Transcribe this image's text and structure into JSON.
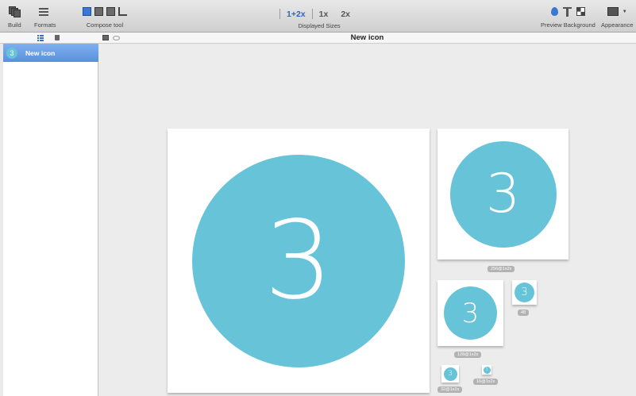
{
  "toolbar": {
    "build_label": "Build",
    "formats_label": "Formats",
    "compose_label": "Compose tool",
    "sizes": [
      {
        "label": "1+2x",
        "active": true
      },
      {
        "label": "1x",
        "active": false
      },
      {
        "label": "2x",
        "active": false
      }
    ],
    "sizes_label": "Displayed Sizes",
    "preview_label": "Preview Background",
    "appearance_label": "Appearance"
  },
  "document": {
    "title": "New icon"
  },
  "sidebar": {
    "items": [
      {
        "label": "New icon",
        "glyph": "3",
        "selected": true
      }
    ]
  },
  "icon": {
    "glyph": "3",
    "color": "#67c4d8",
    "previews": [
      {
        "caption": ""
      },
      {
        "caption": "256@1x2x"
      },
      {
        "caption": "128@1x2x"
      },
      {
        "caption": "48"
      },
      {
        "caption": "32@1x2x"
      },
      {
        "caption": "16@1x2x"
      }
    ]
  },
  "colors": {
    "accent": "#2f68b8",
    "selection": "#6a9fe6",
    "icon_fill": "#67c4d8"
  }
}
